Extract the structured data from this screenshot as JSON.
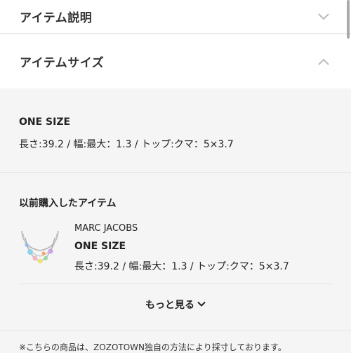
{
  "accordion": {
    "description": {
      "label": "アイテム説明",
      "icon": "chevron-down-icon"
    },
    "size": {
      "label": "アイテムサイズ",
      "icon": "chevron-up-icon"
    }
  },
  "size_info": {
    "size_name": "ONE SIZE",
    "dimensions": "長さ:39.2 / 幅:最大：1.3 / トップ:クマ：5×3.7"
  },
  "previous_purchases": {
    "title": "以前購入したアイテム",
    "item": {
      "brand": "MARC JACOBS",
      "size_name": "ONE SIZE",
      "dimensions": "長さ:39.2 / 幅:最大：1.3 / トップ:クマ：5×3.7"
    },
    "more_label": "もっと見る"
  },
  "footnote": "※こちらの商品は、ZOZOTOWN独自の方法により採寸しております。",
  "colors": {
    "background": "#f5f5f5",
    "panel": "#ffffff",
    "text": "#222222",
    "chevron": "#bbbbbb"
  }
}
